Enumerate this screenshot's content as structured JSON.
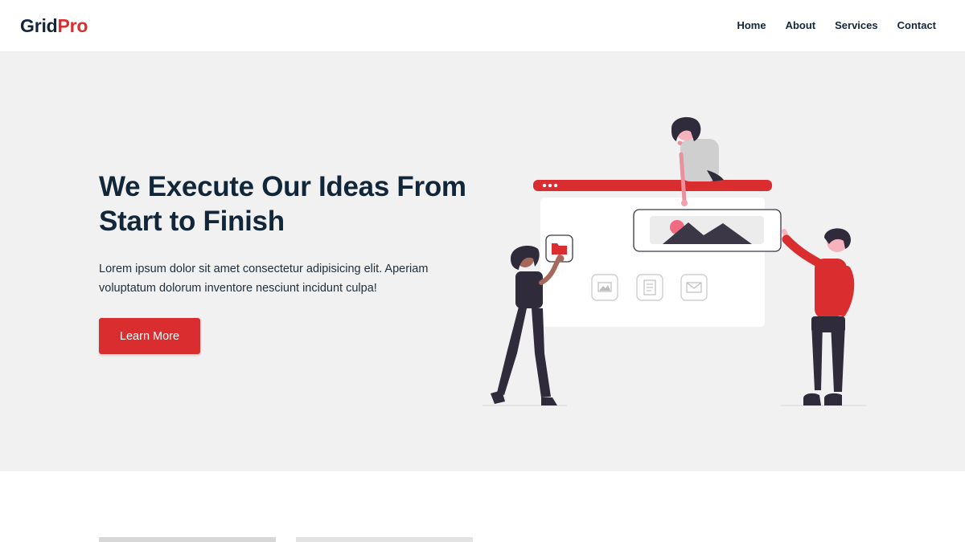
{
  "brand": {
    "part1": "Grid",
    "part2": "Pro",
    "accent": "#d92d2f",
    "dark": "#12263a"
  },
  "nav": {
    "items": [
      {
        "label": "Home"
      },
      {
        "label": "About"
      },
      {
        "label": "Services"
      },
      {
        "label": "Contact"
      }
    ]
  },
  "hero": {
    "title_line1": "We Execute Our Ideas From",
    "title_line2": "Start to Finish",
    "text": "Lorem ipsum dolor sit amet consectetur adipisicing elit. Aperiam voluptatum dolorum inventore nesciunt incidunt culpa!",
    "button_label": "Learn More",
    "background": "#f1f1f1"
  },
  "illustration": {
    "icons": [
      "folder-icon",
      "image-icon",
      "document-icon",
      "mail-icon"
    ]
  }
}
